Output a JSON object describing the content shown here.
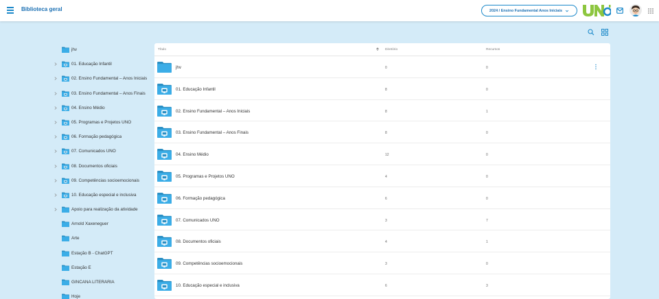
{
  "header": {
    "title": "Biblioteca geral",
    "grade_selector": "2024 / Ensino Fundamental Anos Iniciais",
    "menu_icon": "hamburger-menu-icon",
    "mail_icon": "mail-icon",
    "apps_icon": "apps-grid-icon",
    "logo_text": "UNO"
  },
  "colors": {
    "accent": "#1a88c9",
    "title": "#1a6fb3",
    "folder": "#3bade7",
    "folder_dark": "#2a8fc4",
    "background": "#d4ebf8",
    "logo_green": "#8dc63f",
    "logo_blue": "#1a88c9"
  },
  "toolbar": {
    "search_icon": "search-icon",
    "view_icon": "grid-view-icon"
  },
  "sidebar": {
    "items": [
      {
        "label": "jhv",
        "caret": false,
        "badge": false
      },
      {
        "label": "01. Educação Infantil",
        "caret": true,
        "badge": true
      },
      {
        "label": "02. Ensino Fundamental – Anos Iniciais",
        "caret": true,
        "badge": true
      },
      {
        "label": "03. Ensino Fundamental – Anos Finais",
        "caret": true,
        "badge": true
      },
      {
        "label": "04. Ensino Médio",
        "caret": true,
        "badge": true
      },
      {
        "label": "05. Programas e Projetos UNO",
        "caret": true,
        "badge": true
      },
      {
        "label": "06. Formação pedagógica",
        "caret": true,
        "badge": true
      },
      {
        "label": "07. Comunicados UNO",
        "caret": true,
        "badge": true
      },
      {
        "label": "08. Documentos oficiais",
        "caret": true,
        "badge": true
      },
      {
        "label": "09. Competências socioemocionais",
        "caret": true,
        "badge": true
      },
      {
        "label": "10. Educação especial e inclusiva",
        "caret": true,
        "badge": true
      },
      {
        "label": "Apoio para realização da atividade",
        "caret": true,
        "badge": false
      },
      {
        "label": "Arnold Xaxeneguer",
        "caret": false,
        "badge": false
      },
      {
        "label": "Arte",
        "caret": false,
        "badge": false
      },
      {
        "label": "Estação B - ChatGPT",
        "caret": false,
        "badge": false
      },
      {
        "label": "Estação E",
        "caret": false,
        "badge": false
      },
      {
        "label": "GINCANA LITERÁRIA",
        "caret": false,
        "badge": false
      },
      {
        "label": "Hoje",
        "caret": false,
        "badge": false
      }
    ]
  },
  "table": {
    "columns": {
      "title": "Título",
      "directories": "Diretório",
      "resources": "Recursos"
    },
    "rows": [
      {
        "name": "jhv",
        "directories": "0",
        "resources": "0",
        "badge": false,
        "menu": true
      },
      {
        "name": "01. Educação Infantil",
        "directories": "8",
        "resources": "0",
        "badge": true,
        "menu": false
      },
      {
        "name": "02. Ensino Fundamental – Anos Iniciais",
        "directories": "8",
        "resources": "1",
        "badge": true,
        "menu": false
      },
      {
        "name": "03. Ensino Fundamental – Anos Finais",
        "directories": "8",
        "resources": "0",
        "badge": true,
        "menu": false
      },
      {
        "name": "04. Ensino Médio",
        "directories": "12",
        "resources": "0",
        "badge": true,
        "menu": false
      },
      {
        "name": "05. Programas e Projetos UNO",
        "directories": "4",
        "resources": "0",
        "badge": true,
        "menu": false
      },
      {
        "name": "06. Formação pedagógica",
        "directories": "6",
        "resources": "0",
        "badge": true,
        "menu": false
      },
      {
        "name": "07. Comunicados UNO",
        "directories": "3",
        "resources": "7",
        "badge": true,
        "menu": false
      },
      {
        "name": "08. Documentos oficiais",
        "directories": "4",
        "resources": "1",
        "badge": true,
        "menu": false
      },
      {
        "name": "09. Competências socioemocionais",
        "directories": "3",
        "resources": "0",
        "badge": true,
        "menu": false
      },
      {
        "name": "10. Educação especial e inclusiva",
        "directories": "6",
        "resources": "3",
        "badge": true,
        "menu": false
      }
    ]
  }
}
